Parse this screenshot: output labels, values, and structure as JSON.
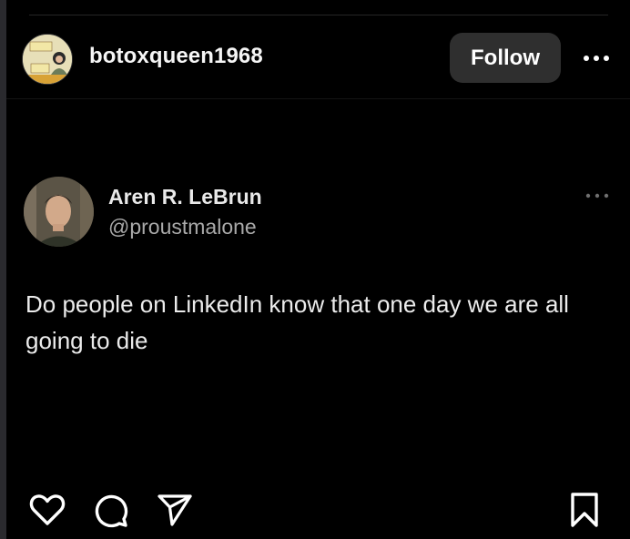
{
  "post": {
    "username": "botoxqueen1968",
    "follow_label": "Follow",
    "more_icon": "more-horizontal-icon"
  },
  "tweet": {
    "name": "Aren R. LeBrun",
    "handle": "@proustmalone",
    "text": "Do people on LinkedIn know that one day we are all going to die",
    "more_icon": "more-horizontal-icon"
  },
  "actions": {
    "like_icon": "heart-icon",
    "comment_icon": "comment-icon",
    "share_icon": "send-icon",
    "save_icon": "bookmark-icon"
  },
  "colors": {
    "background": "#000000",
    "follow_button": "#2f2f2f",
    "text_primary": "#f5f5f5",
    "text_secondary": "#a9a9a9"
  }
}
